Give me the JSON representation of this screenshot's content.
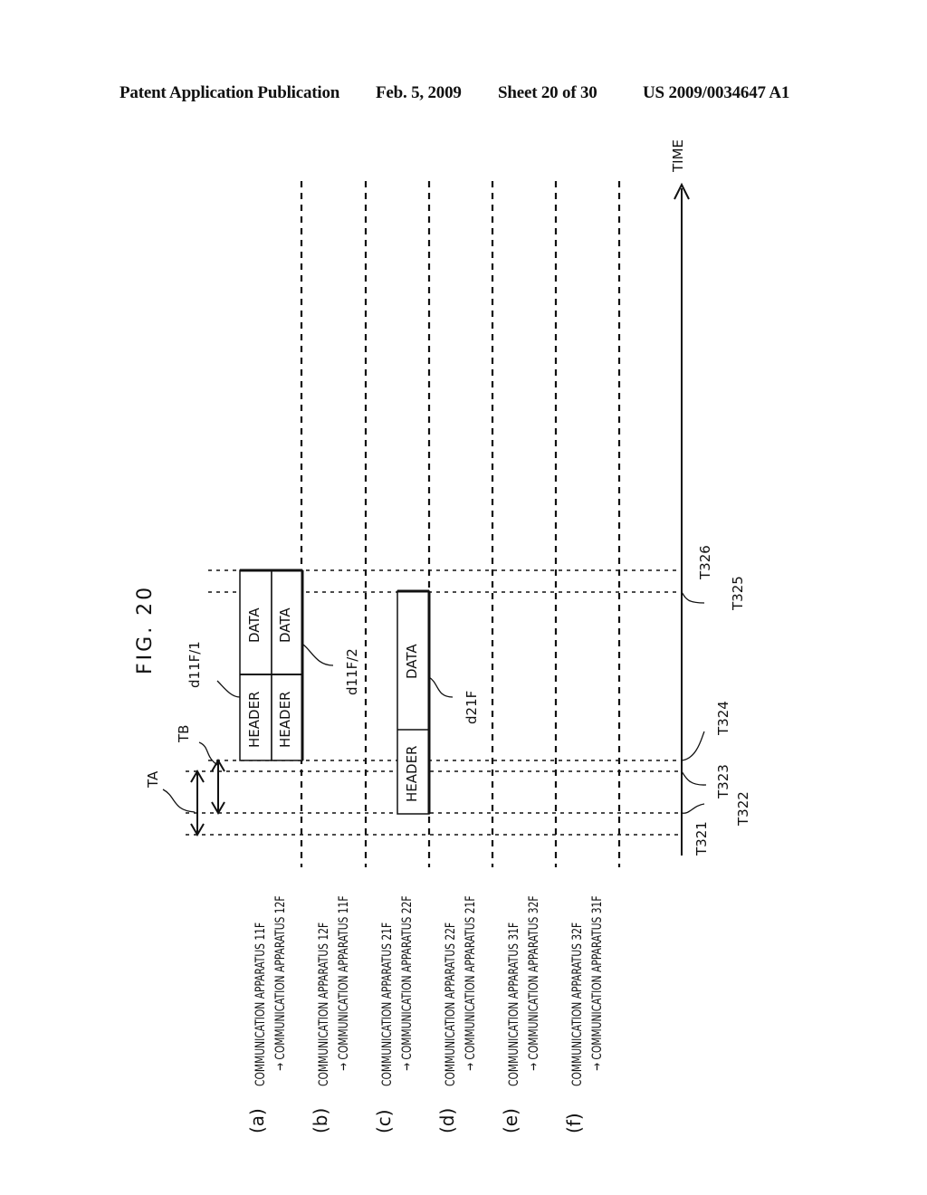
{
  "header": {
    "publication": "Patent Application Publication",
    "date": "Feb. 5, 2009",
    "sheet": "Sheet 20 of 30",
    "number": "US 2009/0034647 A1"
  },
  "figure": {
    "title": "FIG. 20",
    "time_axis_label": "TIME",
    "rows": [
      {
        "letter": "(a)",
        "from": "COMMUNICATION APPARATUS 11F",
        "to": "→ COMMUNICATION APPARATUS 12F"
      },
      {
        "letter": "(b)",
        "from": "COMMUNICATION APPARATUS 12F",
        "to": "→ COMMUNICATION APPARATUS 11F"
      },
      {
        "letter": "(c)",
        "from": "COMMUNICATION APPARATUS 21F",
        "to": "→ COMMUNICATION APPARATUS 22F"
      },
      {
        "letter": "(d)",
        "from": "COMMUNICATION APPARATUS 22F",
        "to": "→ COMMUNICATION APPARATUS 21F"
      },
      {
        "letter": "(e)",
        "from": "COMMUNICATION APPARATUS 31F",
        "to": "→ COMMUNICATION APPARATUS 32F"
      },
      {
        "letter": "(f)",
        "from": "COMMUNICATION APPARATUS 32F",
        "to": "→ COMMUNICATION APPARATUS 31F"
      }
    ],
    "time_labels": [
      "T321",
      "T322",
      "T323",
      "T324",
      "T325",
      "T326"
    ],
    "intervals": {
      "ta": "TA",
      "tb": "TB"
    },
    "frames": [
      {
        "ref": "d11F/1",
        "header": "HEADER",
        "data": "DATA"
      },
      {
        "ref": "d11F/2",
        "header": "HEADER",
        "data": "DATA"
      },
      {
        "ref": "d21F",
        "header": "HEADER",
        "data": "DATA"
      }
    ]
  }
}
